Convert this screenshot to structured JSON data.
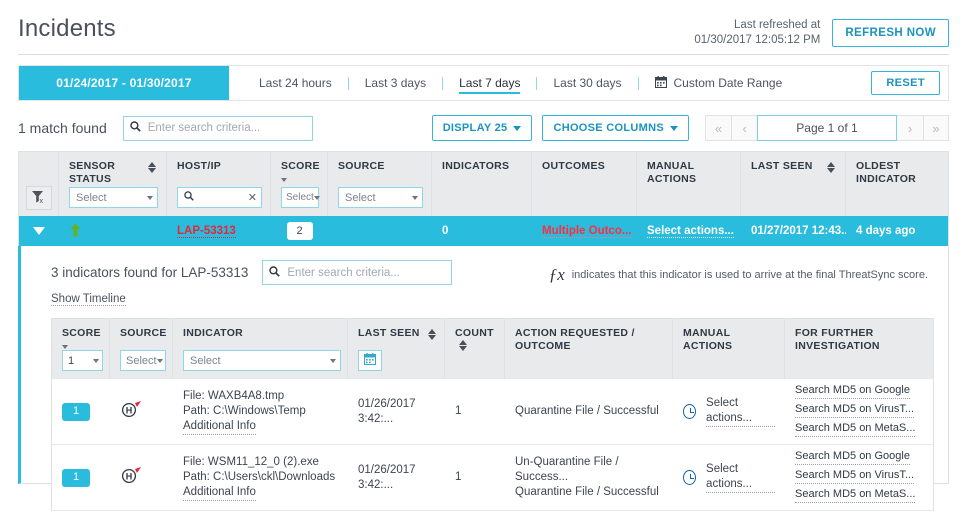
{
  "header": {
    "title": "Incidents",
    "refreshed_label": "Last refreshed at",
    "refreshed_time": "01/30/2017 12:05:12 PM",
    "refresh_button": "REFRESH NOW"
  },
  "daterange": {
    "active_range": "01/24/2017 - 01/30/2017",
    "tabs": [
      {
        "label": "Last 24 hours",
        "selected": false
      },
      {
        "label": "Last 3 days",
        "selected": false
      },
      {
        "label": "Last 7 days",
        "selected": true
      },
      {
        "label": "Last 30 days",
        "selected": false
      }
    ],
    "custom_label": "Custom Date Range",
    "reset_button": "RESET"
  },
  "toolbar": {
    "match_text": "1 match found",
    "search_placeholder": "Enter search criteria...",
    "display_button": "DISPLAY 25",
    "columns_button": "CHOOSE COLUMNS",
    "page_text": "Page 1 of 1"
  },
  "main_table": {
    "columns": [
      {
        "label": "SENSOR STATUS",
        "sortable": true,
        "filter": "Select"
      },
      {
        "label": "HOST/IP",
        "sortable": false,
        "filter": "search"
      },
      {
        "label": "SCORE",
        "sortable": true,
        "filter": "Select"
      },
      {
        "label": "SOURCE",
        "sortable": false,
        "filter": "Select"
      },
      {
        "label": "INDICATORS",
        "sortable": false,
        "filter": ""
      },
      {
        "label": "OUTCOMES",
        "sortable": false,
        "filter": ""
      },
      {
        "label": "MANUAL ACTIONS",
        "sortable": false,
        "filter": ""
      },
      {
        "label": "LAST SEEN",
        "sortable": true,
        "filter": ""
      },
      {
        "label": "OLDEST INDICATOR",
        "sortable": false,
        "filter": ""
      }
    ],
    "selected_row": {
      "host": "LAP-53313",
      "score": "2",
      "indicators": "0",
      "outcomes": "Multiple Outco...",
      "manual_actions": "Select actions...",
      "last_seen": "01/27/2017 12:43...",
      "oldest_indicator": "4 days ago"
    }
  },
  "detail": {
    "title": "3 indicators found for LAP-53313",
    "search_placeholder": "Enter search criteria...",
    "fx_symbol": "ƒx",
    "fx_note": "indicates that this indicator is used to arrive at the final ThreatSync score.",
    "show_timeline": "Show Timeline",
    "columns": [
      {
        "label": "SCORE",
        "sortable": true,
        "filter": "1"
      },
      {
        "label": "SOURCE",
        "sortable": false,
        "filter": "Select"
      },
      {
        "label": "INDICATOR",
        "sortable": false,
        "filter": "Select"
      },
      {
        "label": "LAST SEEN",
        "sortable": true,
        "filter": "calendar"
      },
      {
        "label": "COUNT",
        "sortable": true,
        "filter": ""
      },
      {
        "label": "ACTION REQUESTED / OUTCOME",
        "sortable": false,
        "filter": ""
      },
      {
        "label": "MANUAL ACTIONS",
        "sortable": false,
        "filter": ""
      },
      {
        "label": "FOR FURTHER INVESTIGATION",
        "sortable": false,
        "filter": ""
      }
    ],
    "rows": [
      {
        "score": "1",
        "source_icon": "host-sensor-icon",
        "file_line": "File: WAXB4A8.tmp",
        "path_line": "Path: C:\\Windows\\Temp",
        "additional_info": "Additional Info",
        "last_seen": "01/26/2017 3:42:...",
        "count": "1",
        "outcomes": [
          "Quarantine File / Successful"
        ],
        "manual_actions": "Select actions...",
        "investigation": [
          "Search MD5 on Google",
          "Search MD5 on VirusT...",
          "Search MD5 on MetaS..."
        ]
      },
      {
        "score": "1",
        "source_icon": "host-sensor-icon",
        "file_line": "File: WSM11_12_0 (2).exe",
        "path_line": "Path: C:\\Users\\ckl\\Downloads",
        "additional_info": "Additional Info",
        "last_seen": "01/26/2017 3:42:...",
        "count": "1",
        "outcomes": [
          "Un-Quarantine File / Success...",
          "Quarantine File / Successful"
        ],
        "manual_actions": "Select actions...",
        "investigation": [
          "Search MD5 on Google",
          "Search MD5 on VirusT...",
          "Search MD5 on MetaS..."
        ]
      }
    ]
  },
  "colors": {
    "accent": "#29bcdc",
    "link": "#1b94bd",
    "alert": "#e8253a",
    "ok": "#62b22c"
  }
}
